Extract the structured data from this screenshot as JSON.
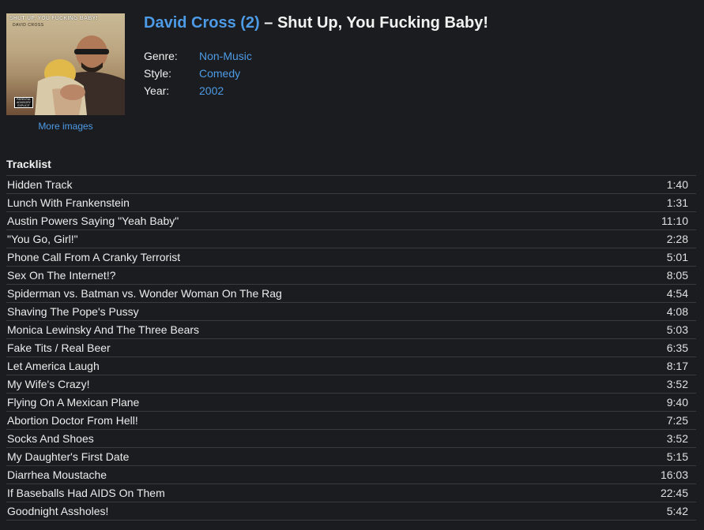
{
  "cover": {
    "title_text": "SHUT UP, YOU FUCKING BABY!",
    "artist_text": "DAVID CROSS",
    "advisory_text": "PARENTAL ADVISORY EXPLICIT CONTENT"
  },
  "more_images_label": "More images",
  "release": {
    "artist": "David Cross (2)",
    "separator": " – ",
    "title": "Shut Up, You Fucking Baby!"
  },
  "meta": [
    {
      "label": "Genre:",
      "value": "Non-Music"
    },
    {
      "label": "Style:",
      "value": "Comedy"
    },
    {
      "label": "Year:",
      "value": "2002"
    }
  ],
  "tracklist_heading": "Tracklist",
  "tracks": [
    {
      "title": "Hidden Track",
      "duration": "1:40"
    },
    {
      "title": "Lunch With Frankenstein",
      "duration": "1:31"
    },
    {
      "title": "Austin Powers Saying \"Yeah Baby\"",
      "duration": "11:10"
    },
    {
      "title": "\"You Go, Girl!\"",
      "duration": "2:28"
    },
    {
      "title": "Phone Call From A Cranky Terrorist",
      "duration": "5:01"
    },
    {
      "title": "Sex On The Internet!?",
      "duration": "8:05"
    },
    {
      "title": "Spiderman vs. Batman vs. Wonder Woman On The Rag",
      "duration": "4:54"
    },
    {
      "title": "Shaving The Pope's Pussy",
      "duration": "4:08"
    },
    {
      "title": "Monica Lewinsky And The Three Bears",
      "duration": "5:03"
    },
    {
      "title": "Fake Tits / Real Beer",
      "duration": "6:35"
    },
    {
      "title": "Let America Laugh",
      "duration": "8:17"
    },
    {
      "title": "My Wife's Crazy!",
      "duration": "3:52"
    },
    {
      "title": "Flying On A Mexican Plane",
      "duration": "9:40"
    },
    {
      "title": "Abortion Doctor From Hell!",
      "duration": "7:25"
    },
    {
      "title": "Socks And Shoes",
      "duration": "3:52"
    },
    {
      "title": "My Daughter's First Date",
      "duration": "5:15"
    },
    {
      "title": "Diarrhea Moustache",
      "duration": "16:03"
    },
    {
      "title": "If Baseballs Had AIDS On Them",
      "duration": "22:45"
    },
    {
      "title": "Goodnight Assholes!",
      "duration": "5:42"
    }
  ],
  "colors": {
    "background": "#1b1c1f",
    "link": "#4d9be6",
    "text": "#ececec",
    "divider": "#3a3b3f"
  }
}
